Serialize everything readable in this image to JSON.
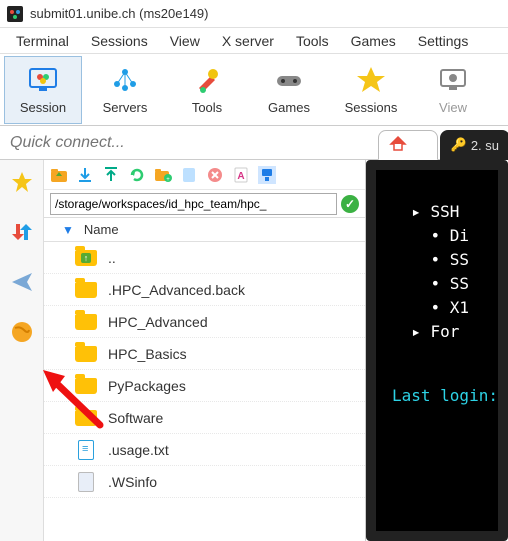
{
  "window": {
    "title": "submit01.unibe.ch (ms20e149)"
  },
  "menubar": [
    "Terminal",
    "Sessions",
    "View",
    "X server",
    "Tools",
    "Games",
    "Settings"
  ],
  "toolbar": [
    {
      "id": "session",
      "label": "Session"
    },
    {
      "id": "servers",
      "label": "Servers"
    },
    {
      "id": "tools",
      "label": "Tools"
    },
    {
      "id": "games",
      "label": "Games"
    },
    {
      "id": "sessions",
      "label": "Sessions"
    },
    {
      "id": "view",
      "label": "View"
    }
  ],
  "quickconnect": {
    "placeholder": "Quick connect..."
  },
  "tabs": {
    "session_label": "2. su"
  },
  "browser": {
    "path": "/storage/workspaces/id_hpc_team/hpc_",
    "header": "Name",
    "items": [
      {
        "type": "up",
        "label": ".."
      },
      {
        "type": "folder",
        "label": ".HPC_Advanced.back"
      },
      {
        "type": "folder",
        "label": "HPC_Advanced"
      },
      {
        "type": "folder",
        "label": "HPC_Basics"
      },
      {
        "type": "folder",
        "label": "PyPackages"
      },
      {
        "type": "folder",
        "label": "Software"
      },
      {
        "type": "txt",
        "label": ".usage.txt"
      },
      {
        "type": "doc",
        "label": ".WSinfo"
      }
    ]
  },
  "terminal": {
    "lines": [
      "  ▸ SSH ",
      "    • Di",
      "    • SS",
      "    • SS",
      "    • X1",
      "",
      "  ▸ For "
    ],
    "last_login": "Last login: "
  }
}
